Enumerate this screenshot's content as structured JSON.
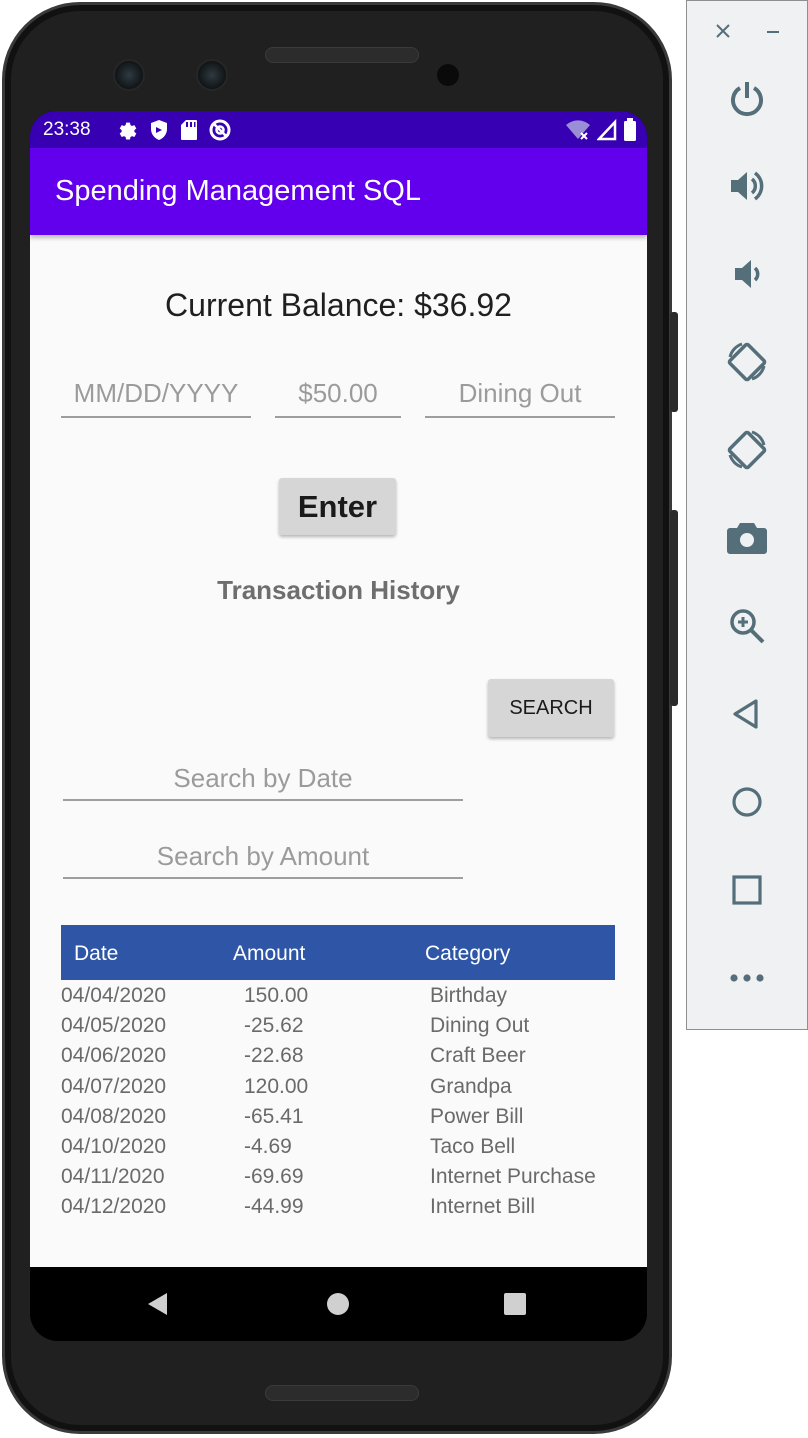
{
  "status_bar": {
    "time": "23:38",
    "left_icons": [
      "gear-icon",
      "shield-icon",
      "sd-card-icon",
      "at-sign-icon"
    ],
    "right_icons": [
      "wifi-icon",
      "signal-icon",
      "battery-icon"
    ]
  },
  "app_bar": {
    "title": "Spending Management SQL"
  },
  "balance": {
    "text": "Current Balance: $36.92"
  },
  "entry_form": {
    "date_placeholder": "MM/DD/YYYY",
    "amount_placeholder": "$50.00",
    "category_placeholder": "Dining Out",
    "enter_label": "Enter"
  },
  "history": {
    "title": "Transaction History"
  },
  "search": {
    "date_placeholder": "Search by Date",
    "amount_placeholder": "Search by Amount",
    "button_label": "SEARCH"
  },
  "table": {
    "columns": [
      "Date",
      "Amount",
      "Category"
    ],
    "rows": [
      {
        "date": "04/04/2020",
        "amount": "150.00",
        "category": "Birthday"
      },
      {
        "date": "04/05/2020",
        "amount": "-25.62",
        "category": "Dining Out"
      },
      {
        "date": "04/06/2020",
        "amount": "-22.68",
        "category": "Craft Beer"
      },
      {
        "date": "04/07/2020",
        "amount": "120.00",
        "category": "Grandpa"
      },
      {
        "date": "04/08/2020",
        "amount": "-65.41",
        "category": "Power Bill"
      },
      {
        "date": "04/10/2020",
        "amount": "-4.69",
        "category": "Taco Bell"
      },
      {
        "date": "04/11/2020",
        "amount": "-69.69",
        "category": "Internet Purchase"
      },
      {
        "date": "04/12/2020",
        "amount": "-44.99",
        "category": "Internet Bill"
      }
    ]
  },
  "nav_bar": {
    "icons": [
      "back-icon",
      "home-icon",
      "recents-icon"
    ]
  },
  "emulator_toolbar": {
    "icons": [
      "close-icon",
      "minimize-icon",
      "power-icon",
      "volume-up-icon",
      "volume-down-icon",
      "rotate-left-icon",
      "rotate-right-icon",
      "camera-icon",
      "zoom-icon",
      "back-icon",
      "home-icon",
      "overview-icon",
      "more-icon"
    ]
  },
  "colors": {
    "status_bar": "#3700b3",
    "app_bar": "#6200ee",
    "table_header": "#2f56a6",
    "toolbar_icon": "#546e7a"
  }
}
